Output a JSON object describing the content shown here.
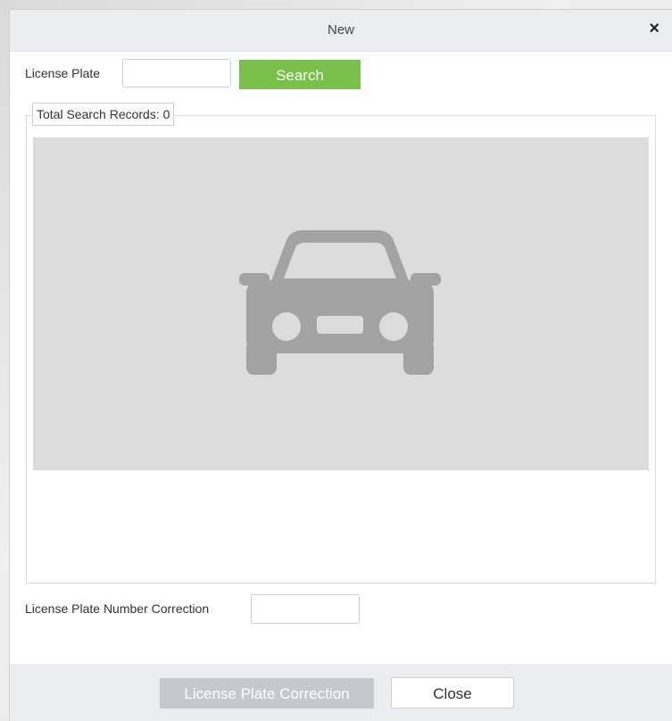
{
  "dialog": {
    "title": "New",
    "close_glyph": "×"
  },
  "search": {
    "label": "License Plate",
    "input_value": "",
    "button_label": "Search"
  },
  "results": {
    "legend": "Total Search Records: 0",
    "placeholder_icon": "car-icon",
    "placeholder_bg": "#dcdcdc",
    "icon_color": "#a3a3a3"
  },
  "correction": {
    "label": "License Plate Number Correction",
    "input_value": ""
  },
  "footer": {
    "correction_button_label": "License Plate Correction",
    "close_button_label": "Close"
  },
  "colors": {
    "accent_green": "#79c04a",
    "disabled_gray": "#c5c9cf"
  }
}
